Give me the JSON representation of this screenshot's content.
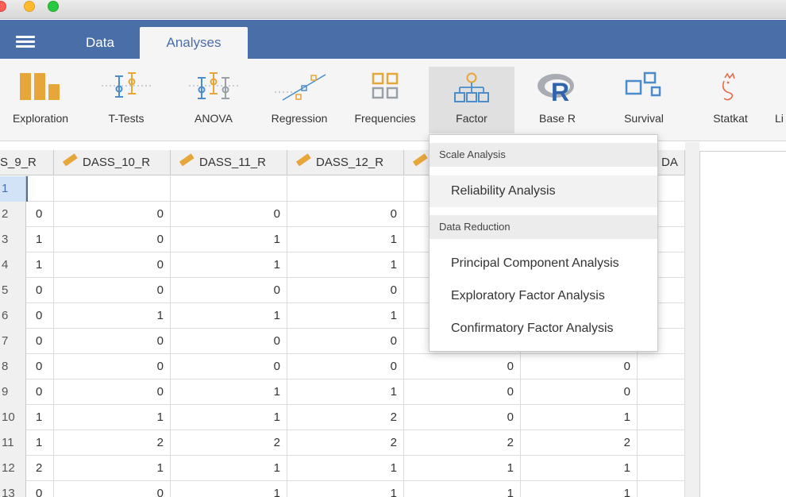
{
  "nav": {
    "data_tab": "Data",
    "analyses_tab": "Analyses"
  },
  "ribbon": [
    {
      "label": "Exploration",
      "icon": "exploration-icon"
    },
    {
      "label": "T-Tests",
      "icon": "ttests-icon"
    },
    {
      "label": "ANOVA",
      "icon": "anova-icon"
    },
    {
      "label": "Regression",
      "icon": "regression-icon"
    },
    {
      "label": "Frequencies",
      "icon": "frequencies-icon"
    },
    {
      "label": "Factor",
      "icon": "factor-icon"
    },
    {
      "label": "Base R",
      "icon": "base-r-icon"
    },
    {
      "label": "Survival",
      "icon": "survival-icon"
    },
    {
      "label": "Statkat",
      "icon": "statkat-icon"
    },
    {
      "label": "Li",
      "icon": "linear-models-icon"
    }
  ],
  "colors": {
    "accent": "#4a6ea8",
    "ordinal_ruler": "#e6a63a",
    "ribbon_orange": "#e6a63a",
    "ribbon_blue": "#4a8ccc"
  },
  "grid": {
    "columns": [
      "S_9_R",
      "DASS_10_R",
      "DASS_11_R",
      "DASS_12_R",
      "",
      "",
      "DA"
    ],
    "rows": [
      {
        "n": "1",
        "v": [
          "",
          "",
          "",
          "",
          "",
          ""
        ]
      },
      {
        "n": "2",
        "v": [
          "0",
          "0",
          "0",
          "0",
          "",
          ""
        ]
      },
      {
        "n": "3",
        "v": [
          "1",
          "0",
          "1",
          "1",
          "",
          ""
        ]
      },
      {
        "n": "4",
        "v": [
          "1",
          "0",
          "1",
          "1",
          "",
          ""
        ]
      },
      {
        "n": "5",
        "v": [
          "0",
          "0",
          "0",
          "0",
          "",
          ""
        ]
      },
      {
        "n": "6",
        "v": [
          "0",
          "1",
          "1",
          "1",
          "",
          ""
        ]
      },
      {
        "n": "7",
        "v": [
          "0",
          "0",
          "0",
          "0",
          "",
          ""
        ]
      },
      {
        "n": "8",
        "v": [
          "0",
          "0",
          "0",
          "0",
          "0",
          "0"
        ]
      },
      {
        "n": "9",
        "v": [
          "0",
          "0",
          "1",
          "1",
          "0",
          "0"
        ]
      },
      {
        "n": "10",
        "v": [
          "1",
          "1",
          "1",
          "2",
          "0",
          "1"
        ]
      },
      {
        "n": "11",
        "v": [
          "1",
          "2",
          "2",
          "2",
          "2",
          "2"
        ]
      },
      {
        "n": "12",
        "v": [
          "2",
          "1",
          "1",
          "1",
          "1",
          "1"
        ]
      },
      {
        "n": "13",
        "v": [
          "0",
          "0",
          "1",
          "1",
          "1",
          "1"
        ]
      }
    ]
  },
  "menu": {
    "section1": "Scale Analysis",
    "item_reliability": "Reliability Analysis",
    "section2": "Data Reduction",
    "item_pca": "Principal Component Analysis",
    "item_efa": "Exploratory Factor Analysis",
    "item_cfa": "Confirmatory Factor Analysis"
  }
}
